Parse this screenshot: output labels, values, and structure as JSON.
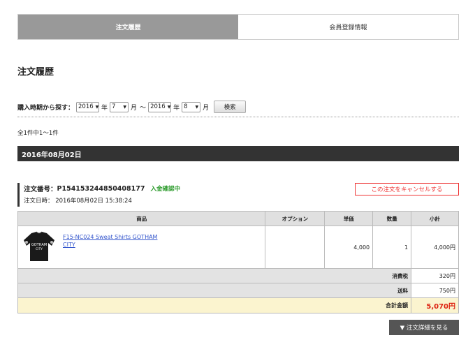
{
  "tabs": [
    {
      "label": "注文履歴"
    },
    {
      "label": "会員登録情報"
    }
  ],
  "page_title": "注文履歴",
  "search": {
    "label": "購入時期から探す：",
    "from_year": "2016",
    "year_unit": "年",
    "from_month": "7",
    "month_unit": "月",
    "tilde": "〜",
    "to_year": "2016",
    "to_month": "8",
    "button": "検索"
  },
  "result_count": "全1件中1〜1件",
  "date_band": "2016年08月02日",
  "order": {
    "number_label": "注文番号：",
    "number": "P154153244850408177",
    "status": "入金確認中",
    "date_label": "注文日時：",
    "date": "2016年08月02日 15:38:24",
    "cancel": "この注文をキャンセルする"
  },
  "table": {
    "headers": [
      "商品",
      "オプション",
      "単価",
      "数量",
      "小計"
    ],
    "rows": [
      {
        "name_line1": "F15-NC024 Sweat Shirts GOTHAM",
        "name_line2": "CITY",
        "option": "",
        "price": "4,000",
        "qty": "1",
        "subtotal": "4,000円"
      }
    ],
    "tax_label": "消費税",
    "tax": "320円",
    "shipping_label": "送料",
    "shipping": "750円",
    "total_label": "合計金額",
    "total": "5,070円"
  },
  "detail_button": "▼ 注文詳細を見る",
  "colors": {
    "accent_red": "#dd2211",
    "status_green": "#2a9a2a",
    "band": "#333333",
    "tab_active": "#999999"
  }
}
